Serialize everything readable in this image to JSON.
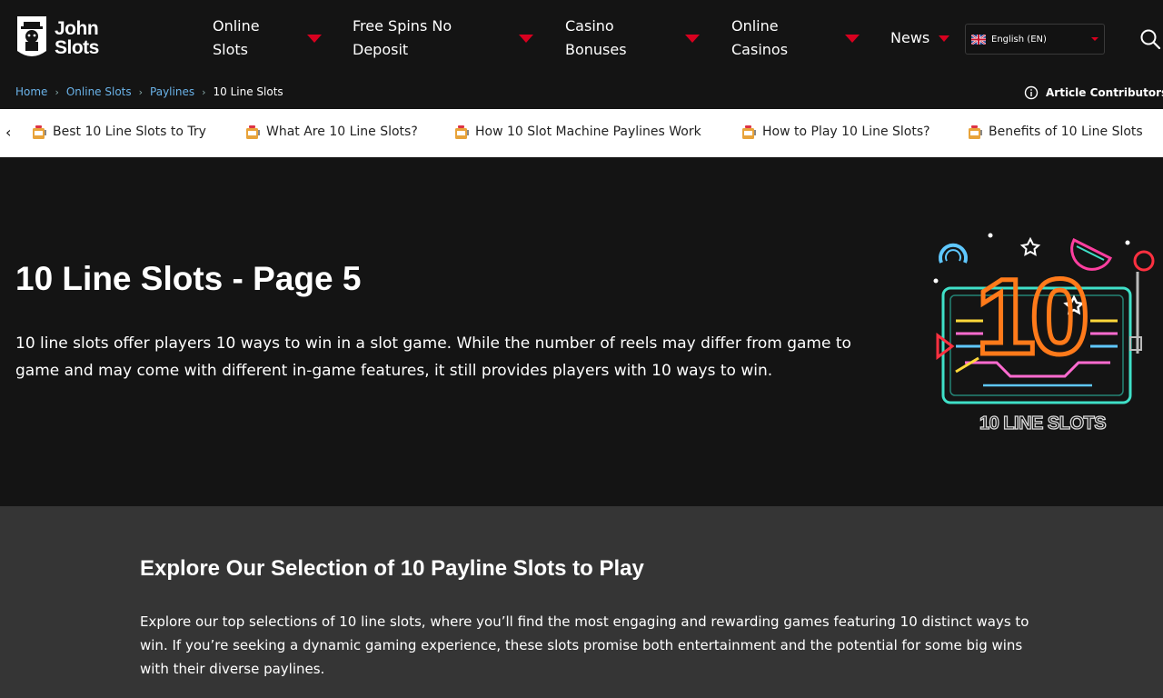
{
  "brand": {
    "line1": "John",
    "line2": "Slots"
  },
  "nav": [
    {
      "label_line1": "Online",
      "label_line2": "Slots"
    },
    {
      "label_line1": "Free Spins No",
      "label_line2": "Deposit"
    },
    {
      "label_line1": "Casino",
      "label_line2": "Bonuses"
    },
    {
      "label_line1": "Online",
      "label_line2": "Casinos"
    },
    {
      "label_line1": "News",
      "label_line2": ""
    }
  ],
  "language": {
    "selected": "English (EN)"
  },
  "breadcrumb": {
    "items": [
      "Home",
      "Online Slots",
      "Paylines"
    ],
    "current": "10 Line Slots"
  },
  "contributors": {
    "label": "Article Contributors:"
  },
  "anchors": [
    "Best 10 Line Slots to Try",
    "What Are 10 Line Slots?",
    "How 10 Slot Machine Paylines Work",
    "How to Play 10 Line Slots?",
    "Benefits of 10 Line Slots"
  ],
  "hero": {
    "title": "10 Line Slots - Page 5",
    "text": "10 line slots offer players 10 ways to win in a slot game. While the number of reels may differ from game to game and may come with different in-game features, it still provides players with 10 ways to win.",
    "art_caption": "10 LINE SLOTS",
    "art_number": "10"
  },
  "section": {
    "title": "Explore Our Selection of 10 Payline Slots to Play",
    "text": "Explore our top selections of 10 line slots, where you’ll find the most engaging and rewarding games featuring 10 distinct ways to win. If you’re seeking a dynamic gaming experience, these slots promise both entertainment and the potential for some big wins with their diverse paylines."
  },
  "colors": {
    "accent_red": "#d8001f",
    "link_blue": "#6ab2e8",
    "neon_orange": "#ff7a1a",
    "neon_teal": "#3fe0c8"
  }
}
